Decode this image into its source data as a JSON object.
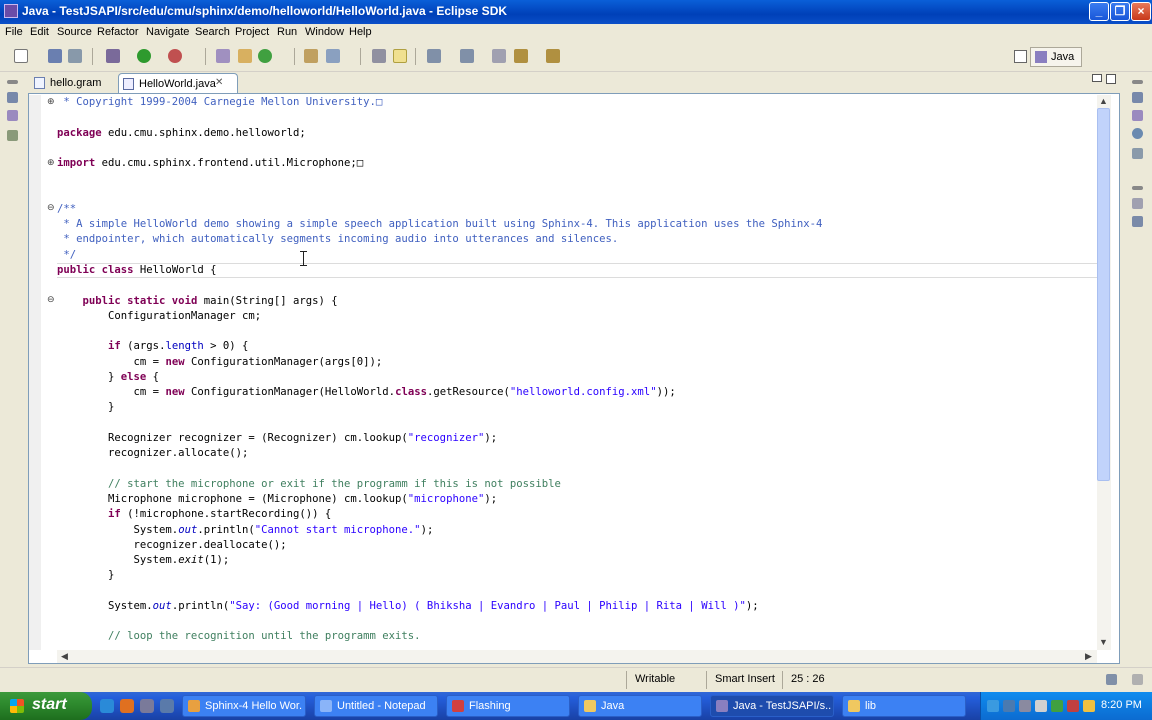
{
  "window": {
    "title": "Java - TestJSAPI/src/edu/cmu/sphinx/demo/helloworld/HelloWorld.java - Eclipse SDK"
  },
  "menu": [
    "File",
    "Edit",
    "Source",
    "Refactor",
    "Navigate",
    "Search",
    "Project",
    "Run",
    "Window",
    "Help"
  ],
  "perspective": {
    "label": "Java"
  },
  "tabs": [
    {
      "label": "hello.gram",
      "active": false
    },
    {
      "label": "HelloWorld.java",
      "active": true
    }
  ],
  "code": [
    [
      [
        "jd",
        " * Copyright 1999-2004 Carnegie Mellon University.□"
      ]
    ],
    [],
    [
      [
        "kw",
        "package"
      ],
      [
        "",
        " edu.cmu.sphinx.demo.helloworld;"
      ]
    ],
    [],
    [
      [
        "kw",
        "import"
      ],
      [
        "",
        " edu.cmu.sphinx.frontend.util.Microphone;□"
      ]
    ],
    [],
    [],
    [
      [
        "jd",
        "/**"
      ]
    ],
    [
      [
        "jd",
        " * A simple HelloWorld demo showing a simple speech application built using Sphinx-4. This application uses the Sphinx-4"
      ]
    ],
    [
      [
        "jd",
        " * endpointer, which automatically segments incoming audio into utterances and silences."
      ]
    ],
    [
      [
        "jd",
        " */"
      ]
    ],
    [
      [
        "kw",
        "public class"
      ],
      [
        "",
        " HelloWorld {"
      ]
    ],
    [],
    [
      [
        "",
        "    "
      ],
      [
        "kw",
        "public static void"
      ],
      [
        "",
        " main(String[] args) {"
      ]
    ],
    [
      [
        "",
        "        ConfigurationManager cm;"
      ]
    ],
    [],
    [
      [
        "",
        "        "
      ],
      [
        "kw",
        "if"
      ],
      [
        "",
        " (args."
      ],
      [
        "fld",
        "length"
      ],
      [
        "",
        " > 0) {"
      ]
    ],
    [
      [
        "",
        "            cm = "
      ],
      [
        "kw",
        "new"
      ],
      [
        "",
        " ConfigurationManager(args[0]);"
      ]
    ],
    [
      [
        "",
        "        } "
      ],
      [
        "kw",
        "else"
      ],
      [
        "",
        " {"
      ]
    ],
    [
      [
        "",
        "            cm = "
      ],
      [
        "kw",
        "new"
      ],
      [
        "",
        " ConfigurationManager(HelloWorld."
      ],
      [
        "kw",
        "class"
      ],
      [
        "",
        ".getResource("
      ],
      [
        "str",
        "\"helloworld.config.xml\""
      ],
      [
        "",
        "));"
      ]
    ],
    [
      [
        "",
        "        }"
      ]
    ],
    [],
    [
      [
        "",
        "        Recognizer recognizer = (Recognizer) cm.lookup("
      ],
      [
        "str",
        "\"recognizer\""
      ],
      [
        "",
        ");"
      ]
    ],
    [
      [
        "",
        "        recognizer.allocate();"
      ]
    ],
    [],
    [
      [
        "cm",
        "        // start the microphone or exit if the programm if this is not possible"
      ]
    ],
    [
      [
        "",
        "        Microphone microphone = (Microphone) cm.lookup("
      ],
      [
        "str",
        "\"microphone\""
      ],
      [
        "",
        ");"
      ]
    ],
    [
      [
        "",
        "        "
      ],
      [
        "kw",
        "if"
      ],
      [
        "",
        " (!microphone.startRecording()) {"
      ]
    ],
    [
      [
        "",
        "            System."
      ],
      [
        "fld it",
        "out"
      ],
      [
        "",
        ".println("
      ],
      [
        "str",
        "\"Cannot start microphone.\""
      ],
      [
        "",
        ");"
      ]
    ],
    [
      [
        "",
        "            recognizer.deallocate();"
      ]
    ],
    [
      [
        "",
        "            System."
      ],
      [
        "it",
        "exit"
      ],
      [
        "",
        "(1);"
      ]
    ],
    [
      [
        "",
        "        }"
      ]
    ],
    [],
    [
      [
        "",
        "        System."
      ],
      [
        "fld it",
        "out"
      ],
      [
        "",
        ".println("
      ],
      [
        "str",
        "\"Say: (Good morning | Hello) ( Bhiksha | Evandro | Paul | Philip | Rita | Will )\""
      ],
      [
        "",
        ");"
      ]
    ],
    [],
    [
      [
        "cm",
        "        // loop the recognition until the programm exits."
      ]
    ]
  ],
  "status": {
    "writable": "Writable",
    "insert_mode": "Smart Insert",
    "position": "25 : 26"
  },
  "taskbar": {
    "start": "start",
    "buttons": [
      {
        "label": "Sphinx-4 Hello Wor...",
        "color": "#e8a040"
      },
      {
        "label": "Untitled - Notepad",
        "color": "#8ab4f8"
      },
      {
        "label": "Flashing",
        "color": "#d04040"
      },
      {
        "label": "Java",
        "color": "#f0c860"
      },
      {
        "label": "Java - TestJSAPI/s...",
        "color": "#8a7fc0"
      },
      {
        "label": "lib",
        "color": "#f0c860"
      }
    ],
    "clock": "8:20 PM"
  }
}
